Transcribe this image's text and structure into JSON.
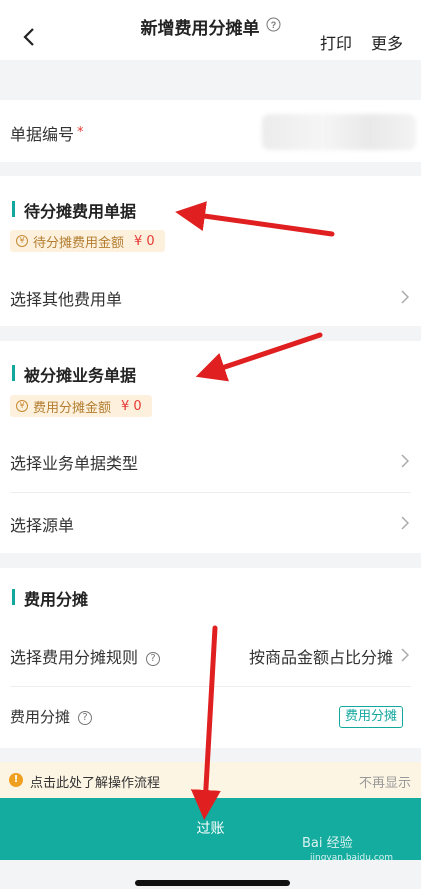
{
  "nav": {
    "title": "新增费用分摊单",
    "print": "打印",
    "more": "更多"
  },
  "doc_number": {
    "label": "单据编号",
    "required_mark": "*"
  },
  "pending_section": {
    "title": "待分摊费用单据",
    "tag_label": "待分摊费用金额",
    "tag_amount": "¥ 0",
    "select_label": "选择其他费用单"
  },
  "business_section": {
    "title": "被分摊业务单据",
    "tag_label": "费用分摊金额",
    "tag_amount": "¥ 0",
    "type_label": "选择业务单据类型",
    "source_label": "选择源单"
  },
  "allocation_section": {
    "title": "费用分摊",
    "rule_label": "选择费用分摊规则",
    "rule_value": "按商品金额占比分摊",
    "alloc_label": "费用分摊",
    "alloc_button": "费用分摊"
  },
  "tip": {
    "text": "点击此处了解操作流程",
    "dismiss": "不再显示"
  },
  "submit": {
    "label": "过账"
  },
  "watermark": {
    "brand": "Bai 经验",
    "url": "jingyan.baidu.com"
  },
  "colors": {
    "accent": "#13a89e",
    "amount": "#e53935",
    "annotation": "#e02020"
  }
}
